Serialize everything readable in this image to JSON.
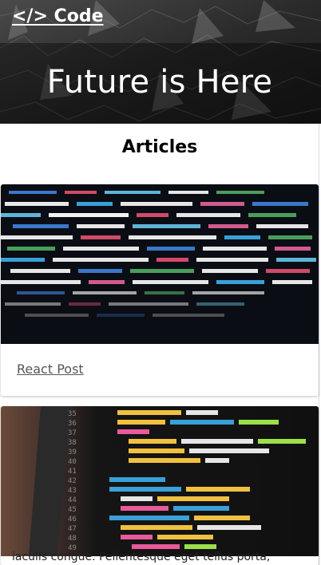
{
  "header": {
    "brand": "</> Code",
    "hero_title": "Future is Here"
  },
  "main": {
    "section_title": "Articles",
    "articles": [
      {
        "link_label": "React Post",
        "image": "code-editor-colorful-photo"
      },
      {
        "link_label": "",
        "image": "python-code-laptop-photo"
      }
    ],
    "peek_text": "iaculis congue. Pellentesque eget tellus porta,"
  },
  "colors": {
    "hero_bg": "#2b2b2b",
    "link": "#555555",
    "text": "#000000"
  }
}
